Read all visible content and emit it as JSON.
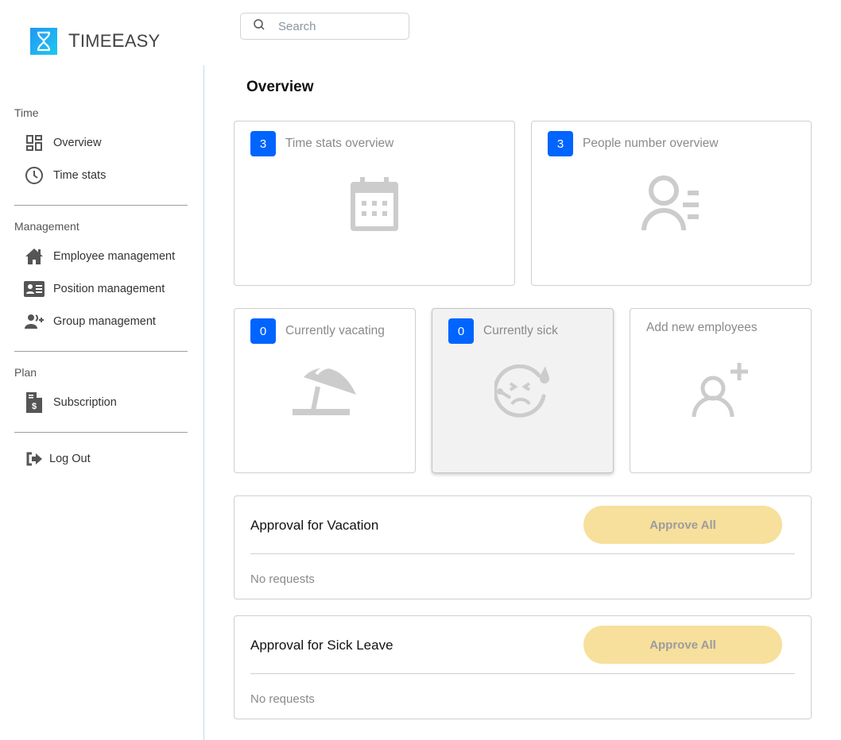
{
  "app": {
    "name_prefix": "T",
    "name_rest1": "IME",
    "name_mid": "E",
    "name_rest2": "ASY",
    "brand_color": "#1e9cf0"
  },
  "search": {
    "placeholder": "Search",
    "value": ""
  },
  "sidebar": {
    "sections": [
      {
        "label": "Time",
        "items": [
          {
            "label": "Overview",
            "icon": "dashboard-icon"
          },
          {
            "label": "Time stats",
            "icon": "clock-icon"
          }
        ]
      },
      {
        "label": "Management",
        "items": [
          {
            "label": "Employee management",
            "icon": "home-icon"
          },
          {
            "label": "Position management",
            "icon": "id-card-icon"
          },
          {
            "label": "Group management",
            "icon": "group-add-icon"
          }
        ]
      },
      {
        "label": "Plan",
        "items": [
          {
            "label": "Subscription",
            "icon": "invoice-dollar-icon"
          }
        ]
      }
    ],
    "logout": {
      "label": "Log Out",
      "icon": "logout-icon"
    }
  },
  "main": {
    "title": "Overview",
    "cards": [
      {
        "count": "3",
        "title": "Time stats overview",
        "icon": "calendar-icon"
      },
      {
        "count": "3",
        "title": "People number overview",
        "icon": "person-list-icon"
      },
      {
        "count": "0",
        "title": "Currently vacating",
        "icon": "beach-umbrella-icon"
      },
      {
        "count": "0",
        "title": "Currently sick",
        "icon": "sick-face-icon"
      },
      {
        "title": "Add new employees",
        "icon": "person-add-icon"
      }
    ],
    "approvals": [
      {
        "title": "Approval for Vacation",
        "button": "Approve All",
        "empty": "No requests"
      },
      {
        "title": "Approval for Sick Leave",
        "button": "Approve All",
        "empty": "No requests"
      }
    ],
    "colors": {
      "badge": "#0064fe",
      "approve_button": "#f7df9c",
      "icon_gray": "#cccccc"
    }
  }
}
